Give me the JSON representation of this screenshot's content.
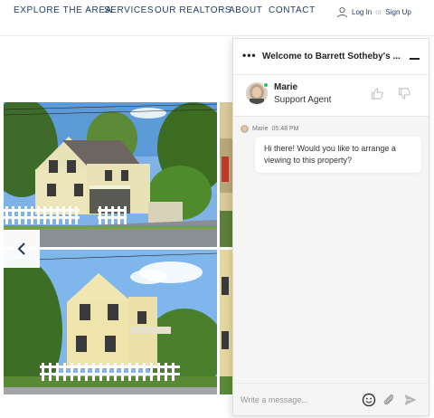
{
  "nav": {
    "items": [
      {
        "label": "EXPLORE THE AREA"
      },
      {
        "label": "SERVICES"
      },
      {
        "label": "OUR REALTORS"
      },
      {
        "label": "ABOUT"
      },
      {
        "label": "CONTACT"
      }
    ],
    "login": "Log In",
    "separator": "or",
    "signup": "Sign Up"
  },
  "chat": {
    "title": "Welcome to Barrett Sotheby's ...",
    "agent": {
      "name": "Marie",
      "role": "Support Agent",
      "status": "online"
    },
    "messages": [
      {
        "sender": "Marie",
        "time": "05:48 PM",
        "text": "Hi there! Would you like to arrange a viewing to this property?"
      }
    ],
    "composer": {
      "placeholder": "Write a message..."
    }
  },
  "colors": {
    "nav_text": "#1f3a5f",
    "online": "#2ec26a"
  },
  "icons": [
    "user-icon",
    "prev-arrow-icon",
    "more-options-icon",
    "minimize-icon",
    "thumbs-up-icon",
    "thumbs-down-icon",
    "emoji-icon",
    "attachment-icon",
    "send-icon"
  ]
}
